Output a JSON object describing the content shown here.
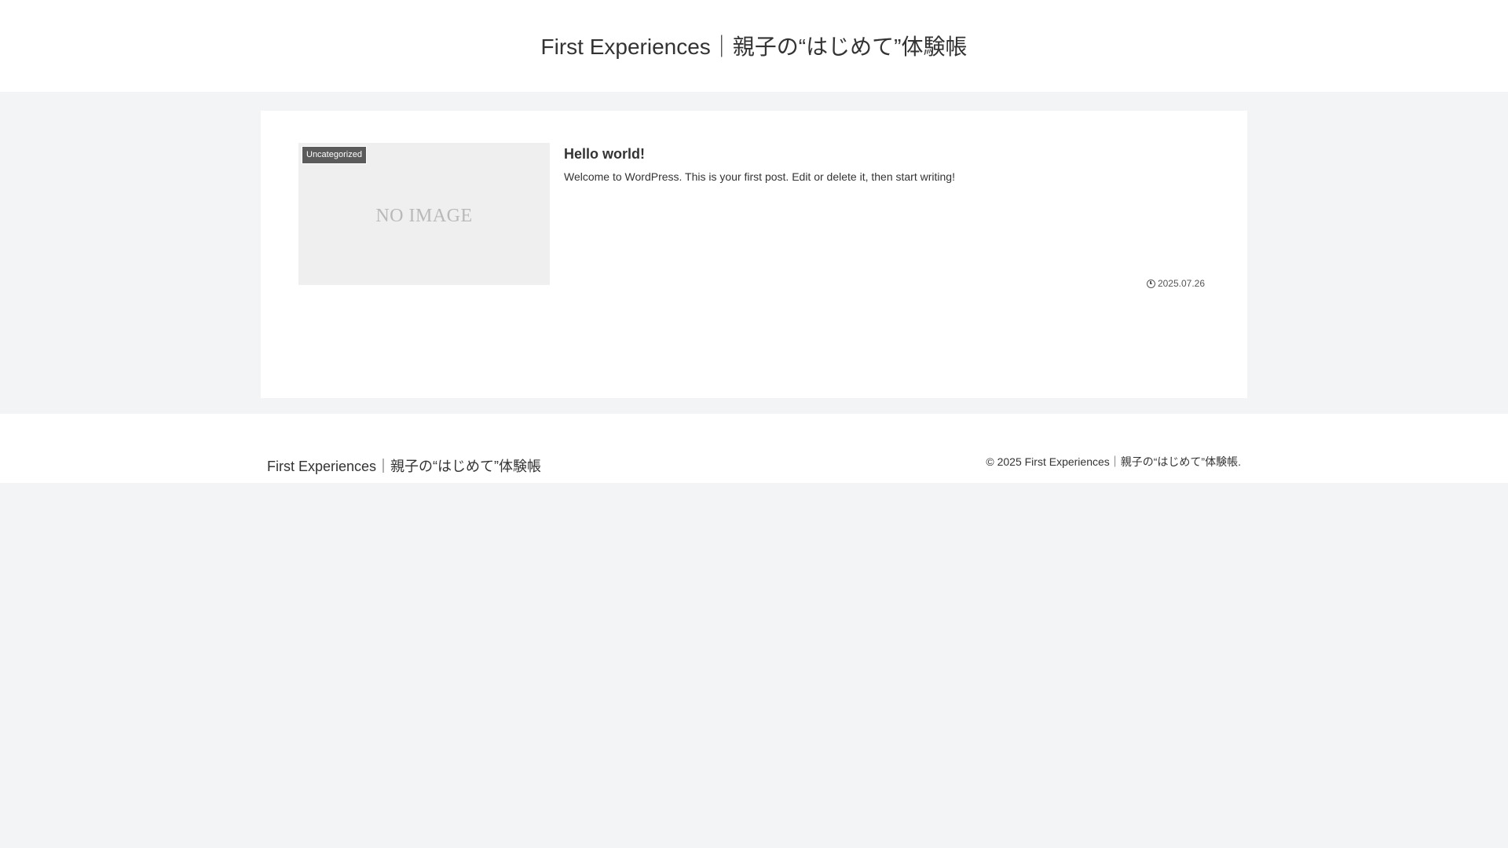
{
  "header": {
    "site_title": "First Experiences｜親子の“はじめて”体験帳"
  },
  "posts": [
    {
      "thumbnail_text": "NO IMAGE",
      "category": "Uncategorized",
      "title": "Hello world!",
      "snippet": "Welcome to WordPress. This is your first post. Edit or delete it, then start writing!",
      "date": "2025.07.26",
      "date_icon": "clock-icon"
    }
  ],
  "footer": {
    "site_title": "First Experiences｜親子の“はじめて”体験帳",
    "copyright": "© 2025 First Experiences｜親子の“はじめて”体験帳."
  },
  "colors": {
    "page_background": "#f3f4f6",
    "card_background": "#ffffff",
    "category_label_background": "#5b5b5b",
    "thumbnail_background": "#efefef"
  }
}
